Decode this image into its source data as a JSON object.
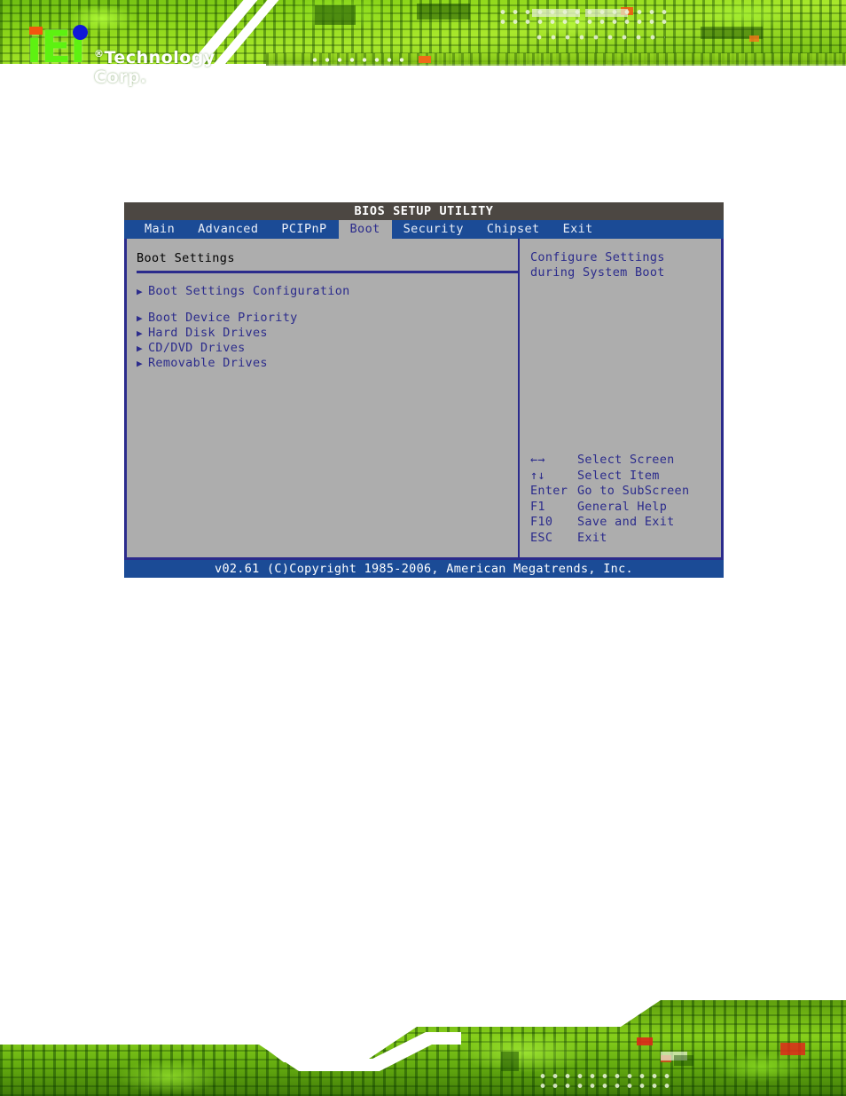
{
  "branding": {
    "logo_text": "iEi",
    "tagline": "Technology Corp.",
    "registered_mark": "®"
  },
  "bios": {
    "title": "BIOS SETUP UTILITY",
    "tabs": [
      {
        "label": "Main",
        "active": false
      },
      {
        "label": "Advanced",
        "active": false
      },
      {
        "label": "PCIPnP",
        "active": false
      },
      {
        "label": "Boot",
        "active": true
      },
      {
        "label": "Security",
        "active": false
      },
      {
        "label": "Chipset",
        "active": false
      },
      {
        "label": "Exit",
        "active": false
      }
    ],
    "section_title": "Boot Settings",
    "menu_items": [
      {
        "label": "Boot Settings Configuration",
        "marker": "▶"
      },
      {
        "label": "Boot Device Priority",
        "marker": "▶"
      },
      {
        "label": "Hard Disk Drives",
        "marker": "▶"
      },
      {
        "label": "CD/DVD Drives",
        "marker": "▶"
      },
      {
        "label": "Removable Drives",
        "marker": "▶"
      }
    ],
    "help": {
      "line1": "Configure Settings",
      "line2": "during System Boot"
    },
    "legend": [
      {
        "key": "←→",
        "desc": "Select Screen"
      },
      {
        "key": "↑↓",
        "desc": "Select Item"
      },
      {
        "key": "Enter",
        "desc": "Go to SubScreen"
      },
      {
        "key": "F1",
        "desc": "General Help"
      },
      {
        "key": "F10",
        "desc": "Save and Exit"
      },
      {
        "key": "ESC",
        "desc": "Exit"
      }
    ],
    "footer": "v02.61 (C)Copyright 1985-2006, American Megatrends, Inc."
  },
  "colors": {
    "titlebar_bg": "#4c4742",
    "tabbar_bg": "#1b4b96",
    "panel_bg": "#adadad",
    "border": "#2b2b8c",
    "text_blue": "#2b2b8c",
    "footer_bg": "#1b4b96",
    "banner_green": "#8ed71a",
    "logo_green": "#5df211",
    "logo_orange": "#f3560e",
    "logo_blue": "#1018d8"
  }
}
